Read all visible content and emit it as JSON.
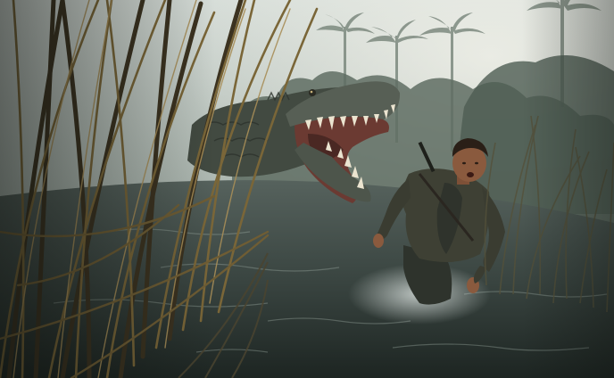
{
  "scene": {
    "kind": "photo-illustration",
    "subjects": [
      "crocodile",
      "man",
      "reeds",
      "swamp-water",
      "palm-trees"
    ],
    "palette": {
      "sky": "#c9d2cf",
      "haze": "#8e9b93",
      "far_trees": "#5a6a5e",
      "water_dark": "#26302c",
      "water_light": "#6f7d78",
      "croc_skin": "#4a5147",
      "croc_mouth": "#7a3f35",
      "teeth": "#e8e2cf",
      "reeds": "#6b5a35",
      "reeds_light": "#a08a55",
      "skin": "#8a5a3e",
      "jacket": "#3d3f34"
    }
  }
}
